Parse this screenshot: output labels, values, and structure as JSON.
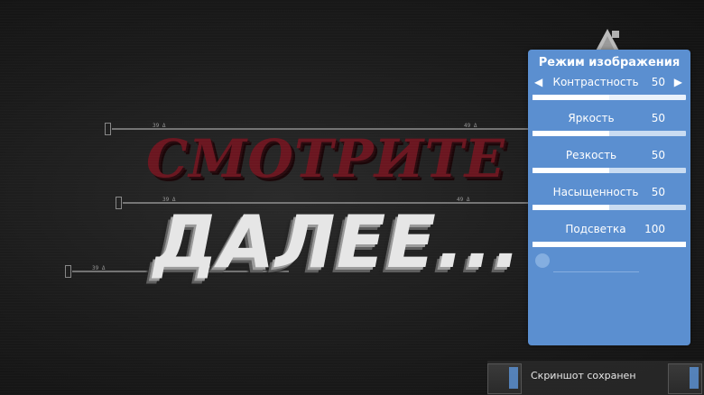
{
  "video": {
    "headline_top": "СМОТРИТЕ",
    "headline_main": "ДАЛЕЕ...",
    "channel_logo_icon": "ren-tv-logo-icon"
  },
  "picture_mode": {
    "title": "Режим изображения",
    "accent_color": "#5b8fd0",
    "prev_icon": "◀",
    "next_icon": "▶",
    "settings": [
      {
        "label": "Контрастность",
        "value": "50",
        "level": 0.5
      },
      {
        "label": "Яркость",
        "value": "50",
        "level": 0.5
      },
      {
        "label": "Резкость",
        "value": "50",
        "level": 0.5
      },
      {
        "label": "Насыщенность",
        "value": "50",
        "level": 0.5
      },
      {
        "label": "Подсветка",
        "value": "100",
        "level": 1.0
      }
    ]
  },
  "toast": {
    "message": "Скриншот сохранен"
  }
}
